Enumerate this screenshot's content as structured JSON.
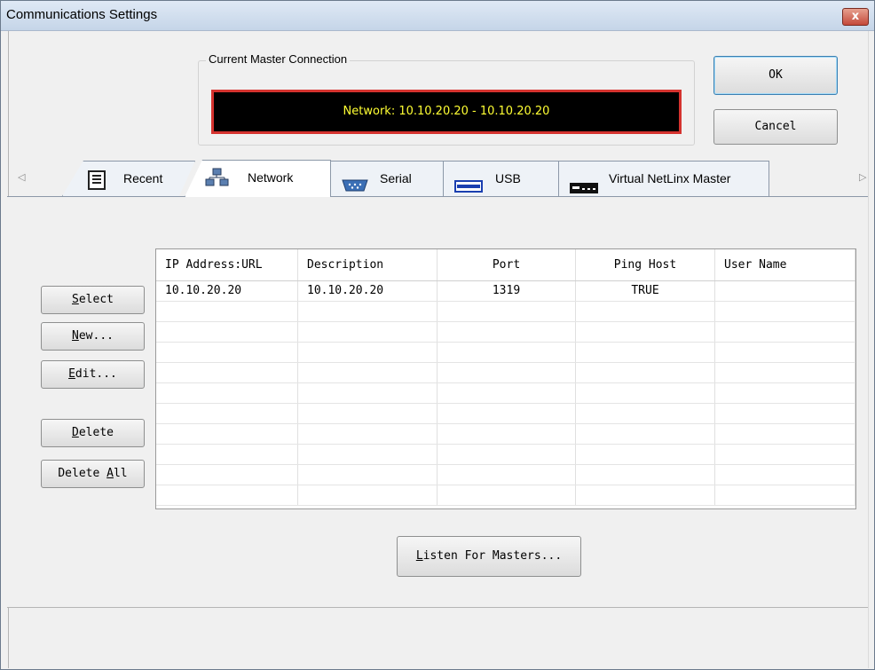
{
  "window": {
    "title": "Communications Settings",
    "close_glyph": "x"
  },
  "connection": {
    "group_label": "Current Master Connection",
    "display_text": "Network: 10.10.20.20 - 10.10.20.20",
    "display_text_color": "#ffff33",
    "display_border_color": "#d5332f"
  },
  "dialog_buttons": {
    "ok": "OK",
    "cancel": "Cancel"
  },
  "tabs": [
    {
      "label": "Recent",
      "icon": "document-icon",
      "active": false
    },
    {
      "label": "Network",
      "icon": "network-icon",
      "active": true
    },
    {
      "label": "Serial",
      "icon": "serial-port-icon",
      "active": false
    },
    {
      "label": "USB",
      "icon": "usb-icon",
      "active": false
    },
    {
      "label": "Virtual NetLinx Master",
      "icon": "virtual-master-icon",
      "active": false
    }
  ],
  "side_buttons": {
    "select": {
      "hot": "S",
      "rest": "elect"
    },
    "new": {
      "hot": "N",
      "rest": "ew..."
    },
    "edit": {
      "hot": "E",
      "rest": "dit..."
    },
    "delete": {
      "hot": "D",
      "rest": "elete"
    },
    "delete_all": {
      "pre": "Delete ",
      "hot": "A",
      "rest": "ll"
    }
  },
  "table": {
    "columns": [
      "IP Address:URL",
      "Description",
      "Port",
      "Ping Host",
      "User Name"
    ],
    "rows": [
      [
        "10.10.20.20",
        "10.10.20.20",
        "1319",
        "TRUE",
        ""
      ]
    ]
  },
  "listen_button": {
    "hot": "L",
    "rest": "isten For Masters..."
  }
}
